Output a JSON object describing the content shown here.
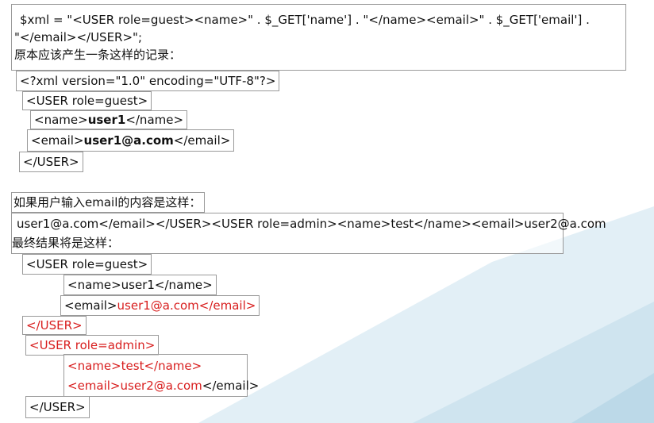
{
  "code_line": {
    "part1": "$xml = \"<USER role=guest><name>\" . $_GET['name'] . \"</name><email>\" . $_GET['email'] .",
    "part2": "\"</email></USER>\";"
  },
  "expected_caption": "原本应该产生一条这样的记录：",
  "expected": {
    "xml_decl": "<?xml version=\"1.0\" encoding=\"UTF-8\"?>",
    "user_open": "<USER role=guest>",
    "name_open": "<name>",
    "name_value": "user1",
    "name_close": "</name>",
    "email_open": "<email>",
    "email_value": "user1@a.com",
    "email_close": "</email>",
    "user_close": "</USER>"
  },
  "input_caption": "如果用户输入email的内容是这样：",
  "malicious_input": "user1@a.com</email></USER><USER role=admin><name>test</name><email>user2@a.com",
  "result_caption": "最终结果将是这样：",
  "result": {
    "user1_open": "<USER role=guest>",
    "name_line": "<name>user1</name>",
    "email_open": "<email>",
    "email_injected": "user1@a.com</email>",
    "user1_close": "</USER>",
    "user2_open": "<USER role=admin>",
    "name2_line": "<name>test</name>",
    "email2_injected": "<email>user2@a.com",
    "email2_close": "</email>",
    "final_close": "</USER>"
  },
  "colors": {
    "injected": "#d81e1e",
    "border": "#9a9a9a",
    "bg_accent": "#d6e8f2"
  }
}
